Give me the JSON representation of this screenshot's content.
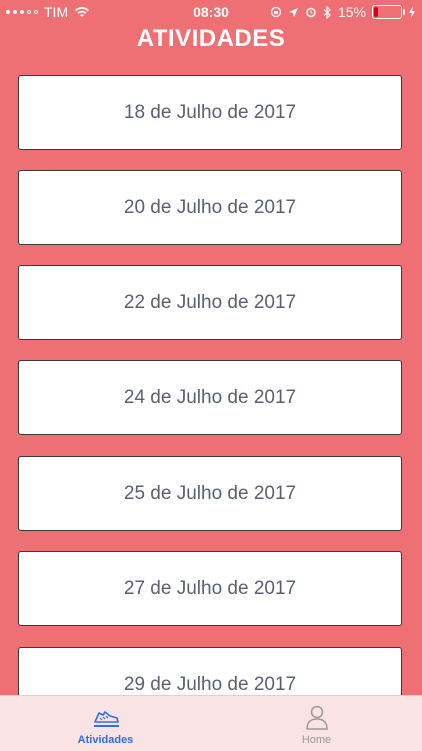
{
  "status_bar": {
    "carrier": "TIM",
    "time": "08:30",
    "battery": "15%",
    "battery_level": 0.15,
    "icons": [
      "wifi-icon",
      "lock-rotation-icon",
      "location-icon",
      "alarm-icon",
      "bluetooth-icon",
      "battery-icon",
      "charging-icon"
    ]
  },
  "header": {
    "title": "ATIVIDADES"
  },
  "activities": [
    {
      "label": "18 de Julho de 2017"
    },
    {
      "label": "20 de Julho de 2017"
    },
    {
      "label": "22 de Julho de 2017"
    },
    {
      "label": "24 de Julho de 2017"
    },
    {
      "label": "25 de Julho de 2017"
    },
    {
      "label": "27 de Julho de 2017"
    },
    {
      "label": "29 de Julho de 2017"
    }
  ],
  "tabbar": {
    "tabs": [
      {
        "label": "Atividades",
        "icon": "running-shoes-icon",
        "active": true
      },
      {
        "label": "Home",
        "icon": "person-icon",
        "active": false
      }
    ]
  },
  "colors": {
    "background": "#ee6f74",
    "card": "#ffffff",
    "card_text": "#596170",
    "tab_active": "#2f6fe4",
    "tab_inactive": "#9a9a9a",
    "tabbar_bg": "#f9e3e3"
  }
}
